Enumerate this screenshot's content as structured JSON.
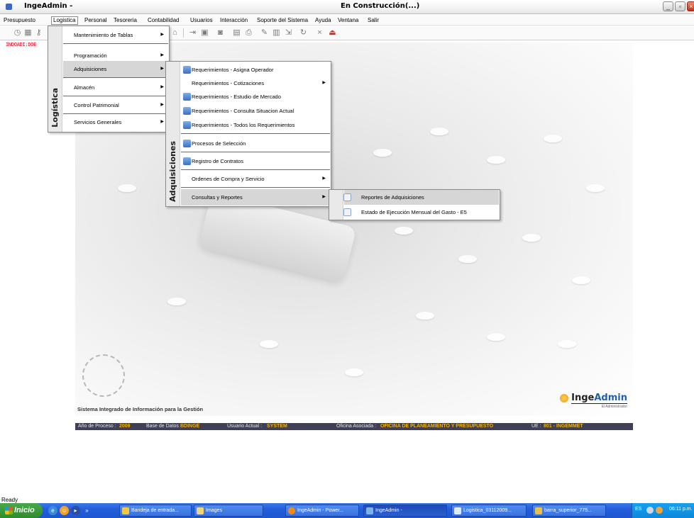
{
  "titlebar": {
    "app_name": "IngeAdmin -",
    "window_title": "En Construcción(...)"
  },
  "menubar": {
    "items": [
      "Presupuesto",
      "Logistica",
      "Personal",
      "Tesoreria",
      "Contabilidad",
      "Usuarios",
      "Interacción",
      "Soporte del Sistema",
      "Ayuda",
      "Ventana",
      "Salir"
    ],
    "active": "Logistica"
  },
  "toolbar": {
    "code_label": "INDOADI:DOE"
  },
  "menus": {
    "logistica": {
      "side_label": "Logística",
      "items": [
        "Mantenimiento de Tablas",
        "Programación",
        "Adquisiciones",
        "Almacén",
        "Control Patrimonial",
        "Servicios Generales"
      ],
      "highlighted": "Adquisiciones"
    },
    "adquisiciones": {
      "side_label": "Adquisiciones",
      "items": [
        "Requerimientos - Asigna Operador",
        "Requerimientos - Cotizaciones",
        "Requerimientos - Estudio de Mercado",
        "Requerimientos - Consulta Situacion Actual",
        "Requerimientos - Todos los Requerimientos",
        "Procesos de Selección",
        "Registro de Contratos",
        "Ordenes de Compra y Servicio",
        "Consultas y Reportes"
      ],
      "highlighted": "Consultas y Reportes"
    },
    "consultas": {
      "items": [
        "Reportes de Adquisiciones",
        "Estado de Ejecución Mensual del Gasto - E5"
      ],
      "highlighted": "Reportes de Adquisiciones"
    }
  },
  "splash": {
    "system_name": "Sistema Integrado de Información para la Gestión",
    "brand_prefix": "Inge",
    "brand_accent": "Admin",
    "brand_tagline": "El Administrador"
  },
  "status_strip": {
    "year_label": "Año de Proceso :",
    "year_value": "2009",
    "db_label": "Base de Datos :",
    "db_value": "BDINGE",
    "user_label": "Usuario Actual :",
    "user_value": "SYSTEM",
    "office_label": "Oficina Asociada :",
    "office_value": "OFICINA DE PLANEAMIENTO Y PRESUPUESTO",
    "ue_label": "UE :",
    "ue_value": "801 - INGEMMET"
  },
  "statusbar": {
    "text": "Ready"
  },
  "taskbar": {
    "start_label": "Inicio",
    "tasks": [
      "Bandeja de entrada...",
      "Images",
      "IngeAdmin - Power...",
      "IngeAdmin -",
      "Logistica_03112009...",
      "barra_superior_775..."
    ],
    "active_task": "IngeAdmin -",
    "language": "ES",
    "clock": "06:11 p.m."
  },
  "colors": {
    "status_strip_bg": "#3f3f57",
    "status_value": "#f4b400",
    "taskbar_blue": "#245edb",
    "start_green": "#2e8b2e",
    "code_red": "#e0001b"
  }
}
